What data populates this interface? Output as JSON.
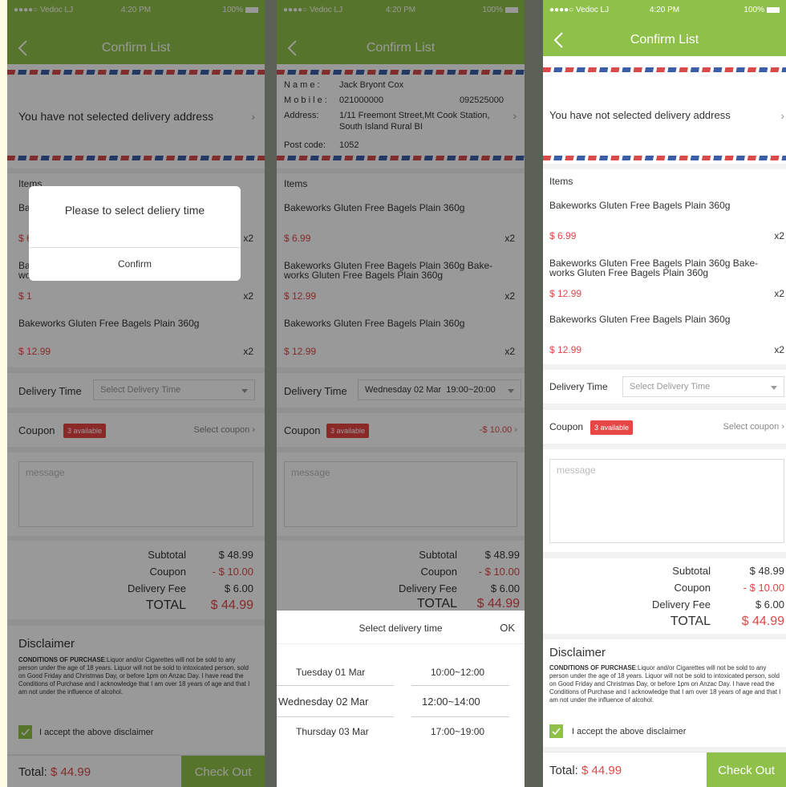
{
  "status_bar": {
    "carrier": "●●●●○ Vedoc LJ",
    "time": "4:20 PM",
    "battery": "100%"
  },
  "nav": {
    "title": "Confirm List"
  },
  "address": {
    "empty_text": "You have not selected delivery address",
    "name_label": "N a m e :",
    "name": "Jack Bryont Cox",
    "mobile_label": "M o b i l e :",
    "mobile": "021000000",
    "mobile2": "092525000",
    "address_label": "Address:",
    "address_line1": "1/11 Freemont Street,Mt Cook Station,",
    "address_line2": "South Island Rural BI",
    "postcode_label": "Post code:",
    "postcode": "1052"
  },
  "items_label": "Items",
  "items": [
    {
      "title": "Bakeworks Gluten Free Bagels Plain 360g",
      "price": "$ 6.99",
      "qty": "x2"
    },
    {
      "title": "Bakeworks Gluten Free Bagels Plain 360g Bake-",
      "title2": "works Gluten Free Bagels Plain 360g",
      "price": "$ 12.99",
      "qty": "x2"
    },
    {
      "title": "Bakeworks Gluten Free Bagels Plain 360g",
      "price": "$ 12.99",
      "qty": "x2"
    }
  ],
  "p1_item2_frag": {
    "a": "Ba",
    "b": "wo"
  },
  "p1_price_frags": {
    "a": "$ 6",
    "b": "$ 1"
  },
  "delivery": {
    "label": "Delivery Time",
    "placeholder": "Select Delivery Time",
    "selected": "Wednesday 02 Mar  19:00~20:00"
  },
  "coupon": {
    "label": "Coupon",
    "badge": "3 available",
    "select": "Select coupon",
    "applied": "-$ 10.00"
  },
  "message_placeholder": "message",
  "summary": {
    "subtotal_label": "Subtotal",
    "subtotal": "$ 48.99",
    "coupon_label": "Coupon",
    "coupon": "- $ 10.00",
    "fee_label": "Delivery Fee",
    "fee": "$ 6.00",
    "total_label": "TOTAL",
    "total": "$ 44.99"
  },
  "disclaimer": {
    "title": "Disclaimer",
    "bold": "CONDITIONS OF PURCHASE",
    "text": ":Liquor and/or Cigarettes will not be sold to any person under the age of 18 years. Liquor will not be sold to intoxicated person, sold on Good Friday and Christmas Day, or before 1pm on Anzac Day. I have read the Conditions of Purchase and I acknowledge that I am over 18 years of age and that I am not under the influence of alcohol.",
    "accept": "I accept the above disclaimer"
  },
  "bottom": {
    "total_label": "Total:",
    "total": "$ 44.99",
    "checkout": "Check Out"
  },
  "modal": {
    "message": "Please to select deliery time",
    "confirm": "Confirm"
  },
  "picker": {
    "title": "Select delivery time",
    "ok": "OK",
    "days": [
      "Tuesday 01 Mar",
      "Wednesday 02 Mar",
      "Thursday 03 Mar"
    ],
    "times": [
      "10:00~12:00",
      "12:00~14:00",
      "17:00~19:00"
    ]
  },
  "colors": {
    "accent": "#8fc14a",
    "price": "#e04848",
    "badge": "#e84545"
  }
}
